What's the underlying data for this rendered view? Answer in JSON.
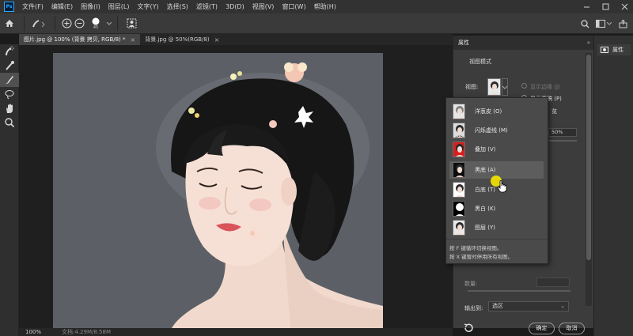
{
  "app": {
    "logo_text": "Ps"
  },
  "menu": [
    "文件(F)",
    "编辑(E)",
    "图像(I)",
    "图层(L)",
    "文字(Y)",
    "选择(S)",
    "滤镜(T)",
    "3D(D)",
    "视图(V)",
    "窗口(W)",
    "帮助(H)"
  ],
  "options": {
    "brush_size": "45"
  },
  "tabs": [
    {
      "label": "图片.jpg @ 100% (背景 拷贝, RGB/8) *"
    },
    {
      "label": "背景.jpg @ 50%(RGB/8)"
    }
  ],
  "status": {
    "zoom": "100%",
    "doc": "文档:4.29M/8.58M"
  },
  "properties": {
    "title": "属性",
    "view_mode_label": "视图模式",
    "view_label": "视图:",
    "show_edge": "显示边缘 (J)",
    "show_original": "显示原稿 (P)",
    "preview_partial": "览",
    "percent": "50%",
    "amount_label": "数量:",
    "output_label": "输出到:",
    "output_value": "选区",
    "ok": "确定",
    "cancel": "取消"
  },
  "dropdown": {
    "items": [
      {
        "label": "洋葱皮 (O)",
        "thumb": "onion"
      },
      {
        "label": "闪烁虚线 (M)",
        "thumb": "marching"
      },
      {
        "label": "叠加 (V)",
        "thumb": "overlay"
      },
      {
        "label": "黑底 (A)",
        "thumb": "black"
      },
      {
        "label": "白底 (T)",
        "thumb": "white"
      },
      {
        "label": "黑白 (K)",
        "thumb": "bw"
      },
      {
        "label": "图层 (Y)",
        "thumb": "layer"
      }
    ],
    "hover_index": 3,
    "hint1": "按 F 键循环切换视图。",
    "hint2": "按 X 键暂时停用所有视图。"
  },
  "dock": {
    "label": "属性"
  },
  "colors": {
    "accent": "#31a8ff",
    "cursor_highlight": "#f5e600",
    "overlay_red": "#d81e1e"
  }
}
